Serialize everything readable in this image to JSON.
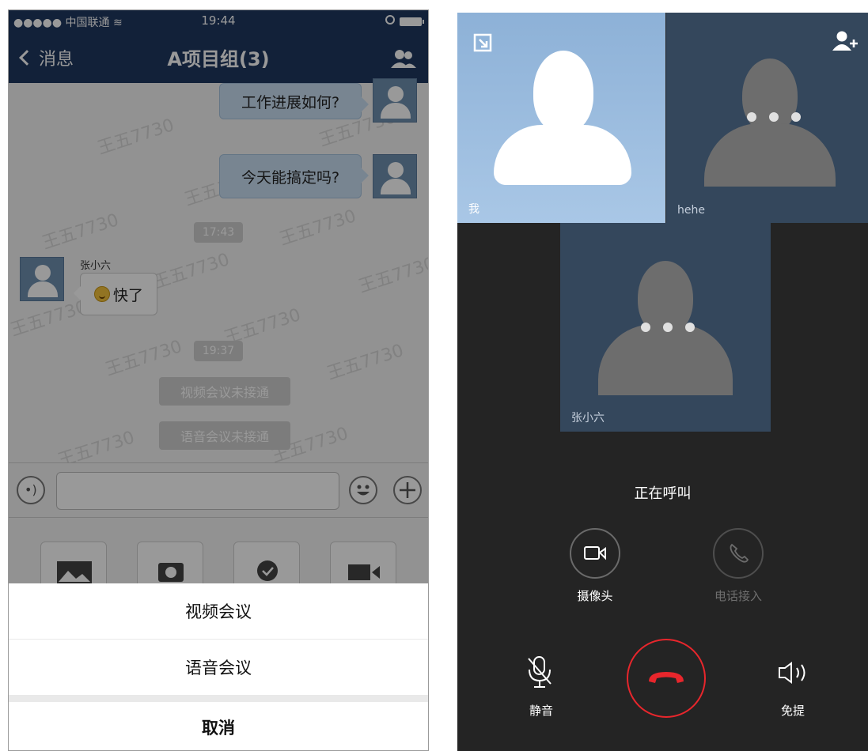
{
  "left_screen": {
    "status_bar": {
      "carrier": "●●●●● 中国联通 ",
      "time": "19:44"
    },
    "nav": {
      "back_label": "消息",
      "title": "A项目组(3)"
    },
    "watermark_text": "王五7730",
    "messages": {
      "m1": "工作进展如何?",
      "m2": "今天能搞定吗?",
      "time1": "17:43",
      "sender": "张小六",
      "m3": "快了",
      "time2": "19:37",
      "sys1": "视频会议未接通",
      "sys2": "语音会议未接通"
    },
    "action_sheet": {
      "video": "视频会议",
      "voice": "语音会议",
      "cancel": "取消"
    }
  },
  "right_screen": {
    "participants": {
      "me": "我",
      "p2": "hehe",
      "p3": "张小六"
    },
    "status": "正在呼叫",
    "buttons": {
      "camera": "摄像头",
      "phone": "电话接入",
      "mute": "静音",
      "speaker": "免提"
    },
    "colors": {
      "hangup": "#e8262c",
      "accent_dark": "#1f3760"
    }
  }
}
